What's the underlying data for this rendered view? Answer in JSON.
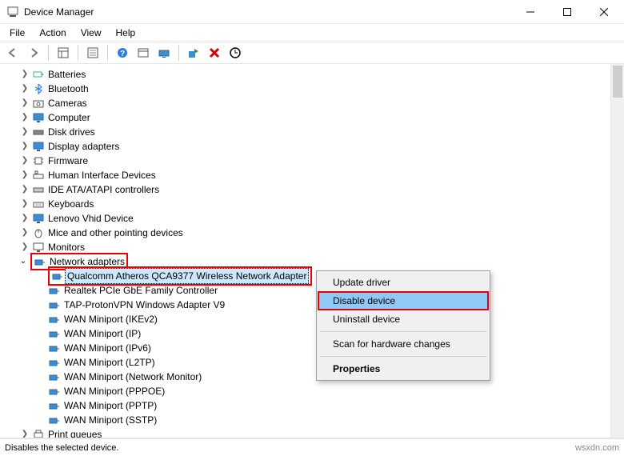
{
  "window": {
    "title": "Device Manager"
  },
  "menu": {
    "file": "File",
    "action": "Action",
    "view": "View",
    "help": "Help"
  },
  "tree": {
    "batteries": "Batteries",
    "bluetooth": "Bluetooth",
    "cameras": "Cameras",
    "computer": "Computer",
    "disk": "Disk drives",
    "display": "Display adapters",
    "firmware": "Firmware",
    "hid": "Human Interface Devices",
    "ide": "IDE ATA/ATAPI controllers",
    "keyboards": "Keyboards",
    "lenovo": "Lenovo Vhid Device",
    "mice": "Mice and other pointing devices",
    "monitors": "Monitors",
    "netadapters": "Network adapters",
    "net": {
      "qualcomm": "Qualcomm Atheros QCA9377 Wireless Network Adapter",
      "realtek": "Realtek PCIe GbE Family Controller",
      "tap": "TAP-ProtonVPN Windows Adapter V9",
      "wan_ikev2": "WAN Miniport (IKEv2)",
      "wan_ip": "WAN Miniport (IP)",
      "wan_ipv6": "WAN Miniport (IPv6)",
      "wan_l2tp": "WAN Miniport (L2TP)",
      "wan_netmon": "WAN Miniport (Network Monitor)",
      "wan_pppoe": "WAN Miniport (PPPOE)",
      "wan_pptp": "WAN Miniport (PPTP)",
      "wan_sstp": "WAN Miniport (SSTP)"
    },
    "printq": "Print queues"
  },
  "context": {
    "update": "Update driver",
    "disable": "Disable device",
    "uninstall": "Uninstall device",
    "scan": "Scan for hardware changes",
    "props": "Properties"
  },
  "status": "Disables the selected device.",
  "watermark": "wsxdn.com"
}
